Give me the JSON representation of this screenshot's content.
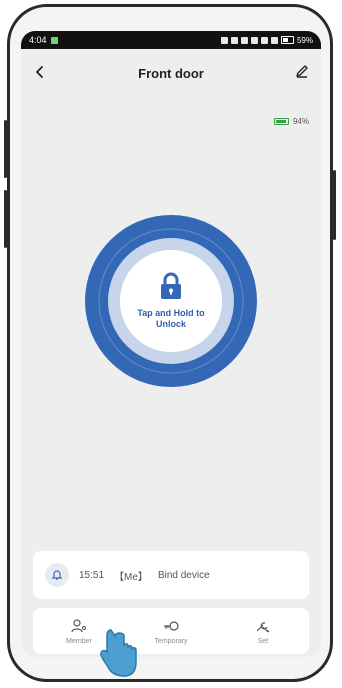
{
  "status_bar": {
    "time": "4:04",
    "battery_percent": "59%"
  },
  "header": {
    "title": "Front door",
    "back_icon": "chevron-left-icon",
    "edit_icon": "pencil-icon"
  },
  "battery": {
    "label": "94%",
    "level": 0.94,
    "color": "#3aa14a"
  },
  "unlock": {
    "label": "Tap and Hold to Unlock",
    "ring_color": "#3368b7",
    "icon": "lock-icon"
  },
  "latest_record": {
    "time": "15:51",
    "user": "【Me】",
    "action": "Bind device",
    "icon": "bell-icon"
  },
  "bottom_nav": [
    {
      "label": "Member",
      "icon": "member-icon"
    },
    {
      "label": "Temporary",
      "icon": "key-icon"
    },
    {
      "label": "Set",
      "icon": "settings-tools-icon"
    }
  ]
}
